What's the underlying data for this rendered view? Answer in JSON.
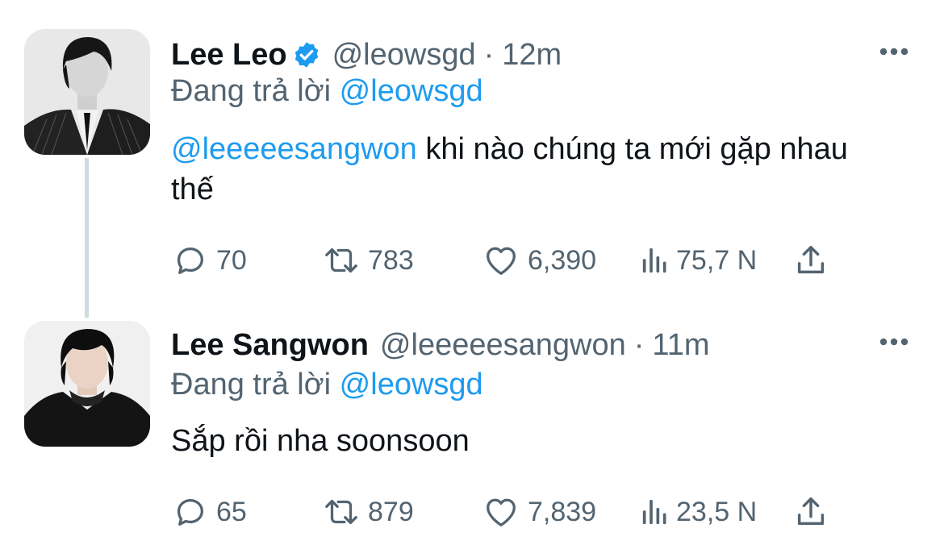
{
  "tweets": [
    {
      "name": "Lee Leo",
      "handle": "@leowsgd",
      "separator": "·",
      "time": "12m",
      "verified": true,
      "replying_prefix": "Đang trả lời",
      "replying_to": "@leowsgd",
      "mention": "@leeeeesangwon",
      "text": " khi nào chúng ta mới gặp nhau thế",
      "replies": "70",
      "retweets": "783",
      "likes": "6,390",
      "views": "75,7 N"
    },
    {
      "name": "Lee Sangwon",
      "handle": "@leeeeesangwon",
      "separator": "·",
      "time": "11m",
      "verified": false,
      "replying_prefix": "Đang trả lời",
      "replying_to": "@leowsgd",
      "text": "Sắp rồi nha soonsoon",
      "replies": "65",
      "retweets": "879",
      "likes": "7,839",
      "views": "23,5 N"
    }
  ],
  "icons": {
    "verified": "verified-badge-icon",
    "more": "more-options-icon",
    "reply": "reply-icon",
    "retweet": "retweet-icon",
    "like": "heart-icon",
    "views": "views-chart-icon",
    "share": "share-icon"
  },
  "colors": {
    "accent": "#1d9bf0",
    "secondary_text": "#536471",
    "primary_text": "#0f1419",
    "thread_line": "#cfd9de"
  }
}
